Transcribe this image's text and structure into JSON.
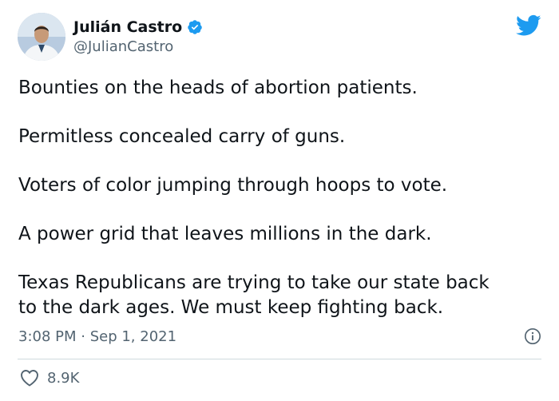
{
  "author": {
    "display_name": "Julián Castro",
    "handle": "@JulianCastro",
    "verified": true
  },
  "tweet": {
    "paragraphs": [
      "Bounties on the heads of abortion patients.",
      "Permitless concealed carry of guns.",
      "Voters of color jumping through hoops to vote.",
      "A power grid that leaves millions in the dark.",
      "Texas Republicans are trying to take our state back\nto the dark ages. We must keep fighting back."
    ],
    "timestamp": "3:08 PM · Sep 1, 2021"
  },
  "engagement": {
    "likes": "8.9K"
  },
  "icons": {
    "brand": "twitter-bird-icon",
    "verified": "verified-badge-icon",
    "info": "info-icon",
    "like": "heart-icon"
  },
  "colors": {
    "twitter_blue": "#1d9bf0",
    "text_primary": "#0f1419",
    "text_secondary": "#536471",
    "divider": "#cfd9de"
  }
}
